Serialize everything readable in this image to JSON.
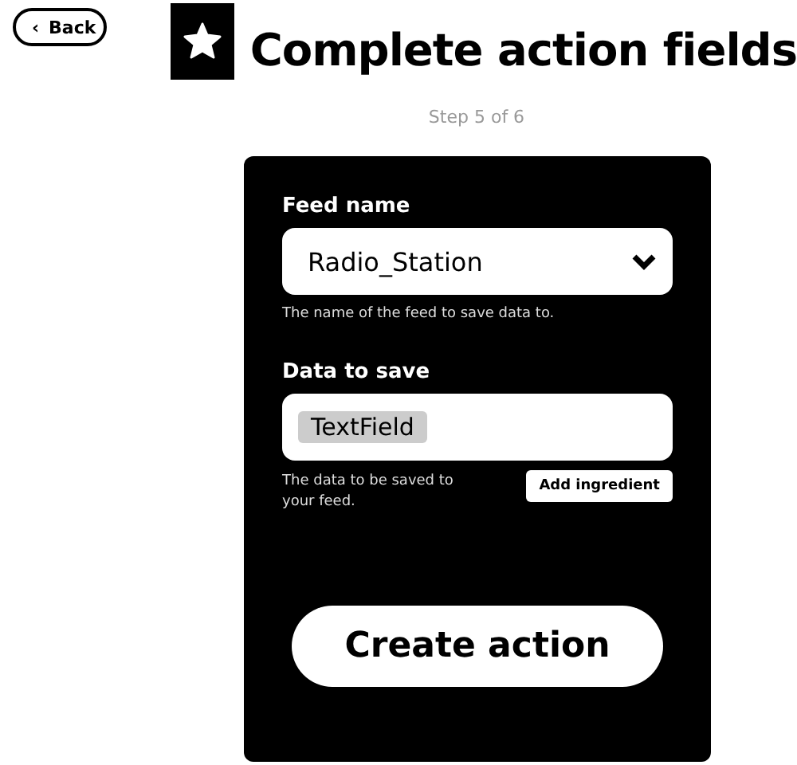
{
  "back_button": {
    "icon": "‹",
    "label": "Back"
  },
  "title": "Complete action fields",
  "step": "Step 5 of 6",
  "form": {
    "fields": [
      {
        "kind": "select",
        "label": "Feed name",
        "value": "Radio_Station",
        "help": "The name of the feed to save data to."
      },
      {
        "kind": "ingredient",
        "label": "Data to save",
        "token": "TextField",
        "help": "The data to be saved to your feed.",
        "button": "Add ingredient"
      }
    ],
    "submit": "Create action"
  }
}
